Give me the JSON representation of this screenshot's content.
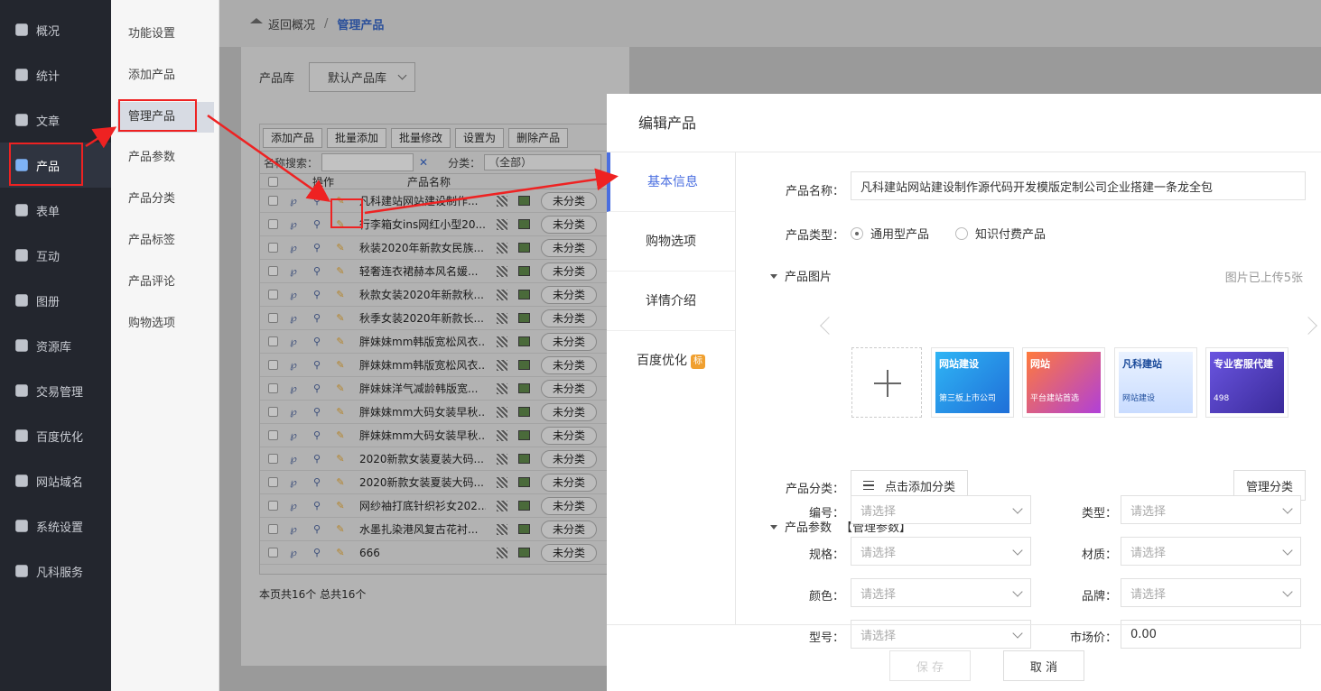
{
  "sidebar": {
    "items": [
      {
        "label": "概况",
        "icon": "home-icon"
      },
      {
        "label": "统计",
        "icon": "chart-icon"
      },
      {
        "label": "文章",
        "icon": "article-icon"
      },
      {
        "label": "产品",
        "icon": "grid-icon"
      },
      {
        "label": "表单",
        "icon": "form-icon"
      },
      {
        "label": "互动",
        "icon": "chat-icon"
      },
      {
        "label": "图册",
        "icon": "gallery-icon"
      },
      {
        "label": "资源库",
        "icon": "database-icon"
      },
      {
        "label": "交易管理",
        "icon": "clipboard-icon"
      },
      {
        "label": "百度优化",
        "icon": "target-icon"
      },
      {
        "label": "网站域名",
        "icon": "w-icon"
      },
      {
        "label": "系统设置",
        "icon": "gear-icon"
      },
      {
        "label": "凡科服务",
        "icon": "heart-icon"
      }
    ]
  },
  "submenu": {
    "items": [
      "功能设置",
      "添加产品",
      "管理产品",
      "产品参数",
      "产品分类",
      "产品标签",
      "产品评论",
      "购物选项"
    ]
  },
  "breadcrumb": {
    "back": "返回概况",
    "sep": "/",
    "current": "管理产品"
  },
  "library": {
    "label": "产品库",
    "value": "默认产品库"
  },
  "toolbar": [
    "添加产品",
    "批量添加",
    "批量修改",
    "设置为",
    "删除产品"
  ],
  "search": {
    "name_label": "名称搜索：",
    "clear": "✕",
    "cat_label": "分类：",
    "cat_value": "（全部）"
  },
  "table": {
    "headers": [
      "操作",
      "产品名称"
    ],
    "rows": [
      {
        "name": "凡科建站网站建设制作...",
        "cat": "未分类"
      },
      {
        "name": "行李箱女ins网红小型20...",
        "cat": "未分类"
      },
      {
        "name": "秋装2020年新款女民族...",
        "cat": "未分类"
      },
      {
        "name": "轻奢连衣裙赫本风名媛...",
        "cat": "未分类"
      },
      {
        "name": "秋款女装2020年新款秋...",
        "cat": "未分类"
      },
      {
        "name": "秋季女装2020年新款长...",
        "cat": "未分类"
      },
      {
        "name": "胖妹妹mm韩版宽松风衣...",
        "cat": "未分类"
      },
      {
        "name": "胖妹妹mm韩版宽松风衣...",
        "cat": "未分类"
      },
      {
        "name": "胖妹妹洋气减龄韩版宽...",
        "cat": "未分类"
      },
      {
        "name": "胖妹妹mm大码女装早秋...",
        "cat": "未分类"
      },
      {
        "name": "胖妹妹mm大码女装早秋...",
        "cat": "未分类"
      },
      {
        "name": "2020新款女装夏装大码...",
        "cat": "未分类"
      },
      {
        "name": "2020新款女装夏装大码...",
        "cat": "未分类"
      },
      {
        "name": "网纱袖打底针织衫女202...",
        "cat": "未分类"
      },
      {
        "name": "水墨扎染港风复古花衬...",
        "cat": "未分类"
      },
      {
        "name": "666",
        "cat": "未分类"
      }
    ],
    "footer": "本页共16个 总共16个"
  },
  "dialog": {
    "title": "编辑产品",
    "tabs": [
      "基本信息",
      "购物选项",
      "详情介绍",
      "百度优化"
    ],
    "seo_badge": "标",
    "name_label": "产品名称：",
    "name_value": "凡科建站网站建设制作源代码开发模版定制公司企业搭建一条龙全包",
    "type_label": "产品类型：",
    "type_opt1": "通用型产品",
    "type_opt2": "知识付费产品",
    "images_label": "产品图片",
    "images_count": "图片已上传5张",
    "thumbs": [
      {
        "big": "网站建设",
        "small": "第三板上市公司"
      },
      {
        "big": "网站",
        "small": "平台建站首选"
      },
      {
        "big": "凡科建站",
        "small": "网站建设"
      },
      {
        "big": "专业客服代建",
        "small": "498"
      }
    ],
    "category_label": "产品分类：",
    "category_btn": "点击添加分类",
    "manage_category": "管理分类",
    "params_label": "产品参数",
    "params_manage": "【管理参数】",
    "params": [
      {
        "label": "编号：",
        "value": "请选择"
      },
      {
        "label": "类型：",
        "value": "请选择"
      },
      {
        "label": "规格：",
        "value": "请选择"
      },
      {
        "label": "材质：",
        "value": "请选择"
      },
      {
        "label": "颜色：",
        "value": "请选择"
      },
      {
        "label": "品牌：",
        "value": "请选择"
      },
      {
        "label": "型号：",
        "value": "请选择"
      },
      {
        "label": "市场价：",
        "value": "0.00"
      }
    ],
    "save": "保 存",
    "cancel": "取 消"
  },
  "colors": {
    "sidebar_bg": "#23262e",
    "accent": "#4a6ee0",
    "annotation": "#ee2222"
  }
}
